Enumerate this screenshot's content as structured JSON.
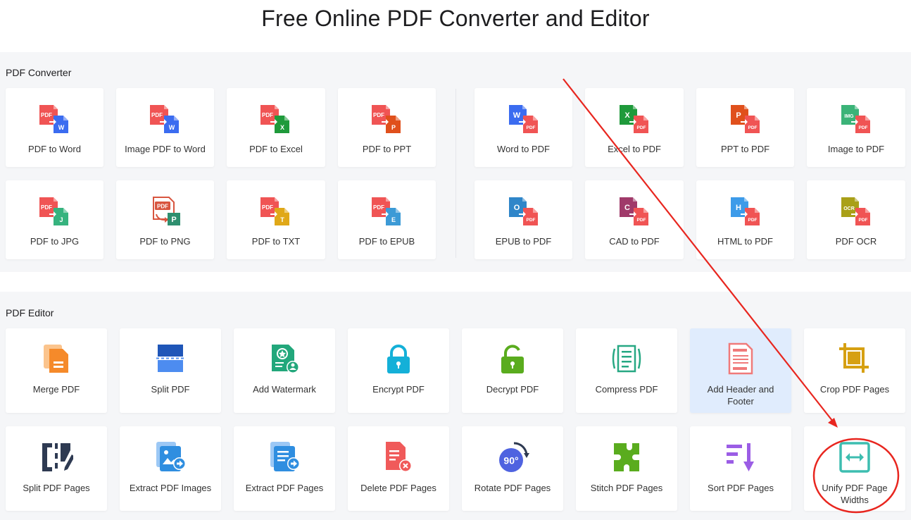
{
  "page": {
    "title": "Free Online PDF Converter and Editor"
  },
  "converter": {
    "label": "PDF Converter",
    "cards": [
      {
        "label": "PDF to Word",
        "icon": "pdf-to-word-icon",
        "tag": "W",
        "color": "#3b6cf0"
      },
      {
        "label": "Image PDF to Word",
        "icon": "image-pdf-to-word-icon",
        "tag": "W",
        "color": "#3b6cf0"
      },
      {
        "label": "PDF to Excel",
        "icon": "pdf-to-excel-icon",
        "tag": "X",
        "color": "#1f9a3b"
      },
      {
        "label": "PDF to PPT",
        "icon": "pdf-to-ppt-icon",
        "tag": "P",
        "color": "#e0501c"
      },
      {
        "label": "Word to PDF",
        "icon": "word-to-pdf-icon",
        "tag": "W",
        "color": "#3b6cf0"
      },
      {
        "label": "Excel to PDF",
        "icon": "excel-to-pdf-icon",
        "tag": "X",
        "color": "#1f9a3b"
      },
      {
        "label": "PPT to PDF",
        "icon": "ppt-to-pdf-icon",
        "tag": "P",
        "color": "#e0501c"
      },
      {
        "label": "Image to PDF",
        "icon": "image-to-pdf-icon",
        "tag": "IMG",
        "color": "#3bb378"
      },
      {
        "label": "PDF to JPG",
        "icon": "pdf-to-jpg-icon",
        "tag": "J",
        "color": "#36b37e"
      },
      {
        "label": "PDF to PNG",
        "icon": "pdf-to-png-icon",
        "tag": "P",
        "color": "#2f8f6f"
      },
      {
        "label": "PDF to TXT",
        "icon": "pdf-to-txt-icon",
        "tag": "T",
        "color": "#e0a818"
      },
      {
        "label": "PDF to EPUB",
        "icon": "pdf-to-epub-icon",
        "tag": "E",
        "color": "#3c9ad6"
      },
      {
        "label": "EPUB to PDF",
        "icon": "epub-to-pdf-icon",
        "tag": "O",
        "color": "#2f86c9"
      },
      {
        "label": "CAD to PDF",
        "icon": "cad-to-pdf-icon",
        "tag": "C",
        "color": "#a03a6a"
      },
      {
        "label": "HTML to PDF",
        "icon": "html-to-pdf-icon",
        "tag": "H",
        "color": "#3d9be9"
      },
      {
        "label": "PDF OCR",
        "icon": "pdf-ocr-icon",
        "tag": "OCR",
        "color": "#a9a018"
      }
    ],
    "pdf_tag": "PDF",
    "png_pdf_tag": "PDF"
  },
  "editor": {
    "label": "PDF Editor",
    "cards": [
      {
        "label": "Merge PDF",
        "icon": "merge-pdf-icon",
        "color": "#f58a2a"
      },
      {
        "label": "Split PDF",
        "icon": "split-pdf-icon",
        "color": "#1f56b8"
      },
      {
        "label": "Add Watermark",
        "icon": "add-watermark-icon",
        "color": "#22a77b"
      },
      {
        "label": "Encrypt PDF",
        "icon": "encrypt-pdf-icon",
        "color": "#14b0d8"
      },
      {
        "label": "Decrypt PDF",
        "icon": "decrypt-pdf-icon",
        "color": "#5aac1e"
      },
      {
        "label": "Compress PDF",
        "icon": "compress-pdf-icon",
        "color": "#27a883"
      },
      {
        "label": "Add Header and Footer",
        "icon": "add-header-footer-icon",
        "color": "#f07a7a"
      },
      {
        "label": "Crop PDF Pages",
        "icon": "crop-pdf-pages-icon",
        "color": "#d6a012"
      },
      {
        "label": "Split PDF Pages",
        "icon": "split-pdf-pages-icon",
        "color": "#2e3a52"
      },
      {
        "label": "Extract PDF Images",
        "icon": "extract-pdf-images-icon",
        "color": "#2f8ee0"
      },
      {
        "label": "Extract PDF Pages",
        "icon": "extract-pdf-pages-icon",
        "color": "#2f8ee0"
      },
      {
        "label": "Delete PDF Pages",
        "icon": "delete-pdf-pages-icon",
        "color": "#f05a5a"
      },
      {
        "label": "Rotate PDF Pages",
        "icon": "rotate-pdf-pages-icon",
        "color": "#4f63e0"
      },
      {
        "label": "Stitch PDF Pages",
        "icon": "stitch-pdf-pages-icon",
        "color": "#5aac1e"
      },
      {
        "label": "Sort PDF Pages",
        "icon": "sort-pdf-pages-icon",
        "color": "#9b5de5"
      },
      {
        "label": "Unify PDF Page Widths",
        "icon": "unify-pdf-page-widths-icon",
        "color": "#3dbdb0"
      }
    ],
    "rotate_badge": "90°"
  },
  "colors": {
    "pdf_red": "#f05454",
    "annotation": "#e8261f",
    "highlight_card": "#e0ecfd"
  }
}
